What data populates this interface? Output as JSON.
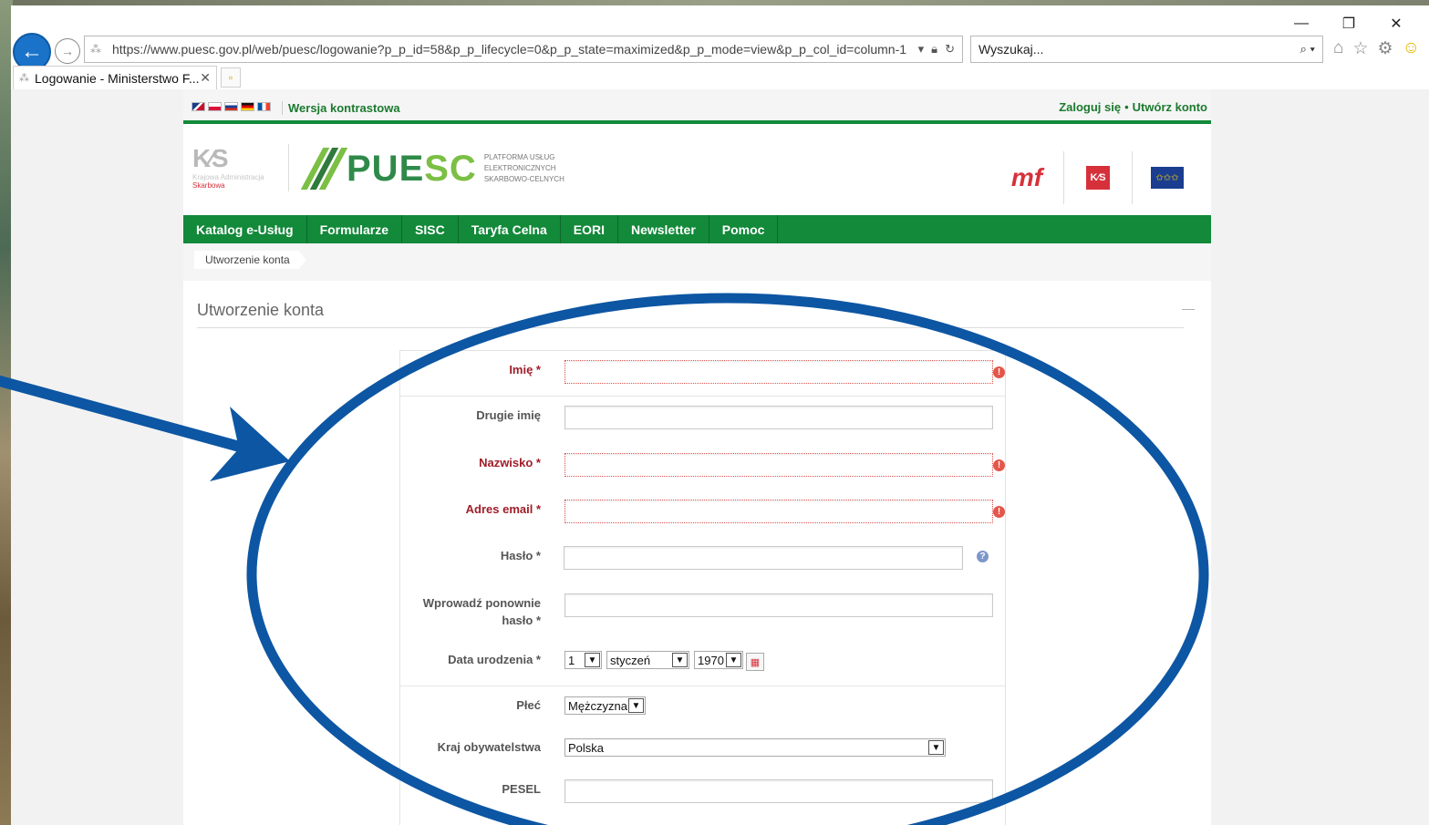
{
  "browser": {
    "url": "https://www.puesc.gov.pl/web/puesc/logowanie?p_p_id=58&p_p_lifecycle=0&p_p_state=maximized&p_p_mode=view&p_p_col_id=column-1",
    "search_placeholder": "Wyszukaj...",
    "tab_title": "Logowanie - Ministerstwo F...",
    "win_minimize": "—",
    "win_restore": "❐",
    "win_close": "✕"
  },
  "site": {
    "contrast_link": "Wersja kontrastowa",
    "login_link": "Zaloguj się",
    "links_separator": "•",
    "create_account_link": "Utwórz konto",
    "kas_mark": "K⁄S",
    "kas_name": "Krajowa Administracja",
    "kas_name2": "Skarbowa",
    "puesc_word_a": "PUE",
    "puesc_word_b": "SC",
    "puesc_tagline": "PLATFORMA USŁUG ELEKTRONICZNYCH SKARBOWO-CELNYCH",
    "mf_logo": "mf",
    "kas_red": "K⁄S",
    "eu_stars": "✩✩✩"
  },
  "nav": {
    "items": [
      "Katalog e-Usług",
      "Formularze",
      "SISC",
      "Taryfa Celna",
      "EORI",
      "Newsletter",
      "Pomoc"
    ]
  },
  "breadcrumb": "Utworzenie konta",
  "panel": {
    "title": "Utworzenie konta",
    "minimize": "—"
  },
  "form": {
    "first_name_label": "Imię *",
    "middle_name_label": "Drugie imię",
    "last_name_label": "Nazwisko *",
    "email_label": "Adres email *",
    "password_label": "Hasło *",
    "password_repeat_label_1": "Wprowadź ponownie",
    "password_repeat_label_2": "hasło *",
    "birthdate_label": "Data urodzenia *",
    "birth_day": "1",
    "birth_month": "styczeń",
    "birth_year": "1970",
    "gender_label": "Płeć",
    "gender_value": "Mężczyzna",
    "citizenship_label": "Kraj obywatelstwa",
    "citizenship_value": "Polska",
    "pesel_label": "PESEL"
  },
  "colors": {
    "brand_green": "#13893a",
    "required_red": "#a01d28",
    "annotation_blue": "#0d56a3"
  }
}
